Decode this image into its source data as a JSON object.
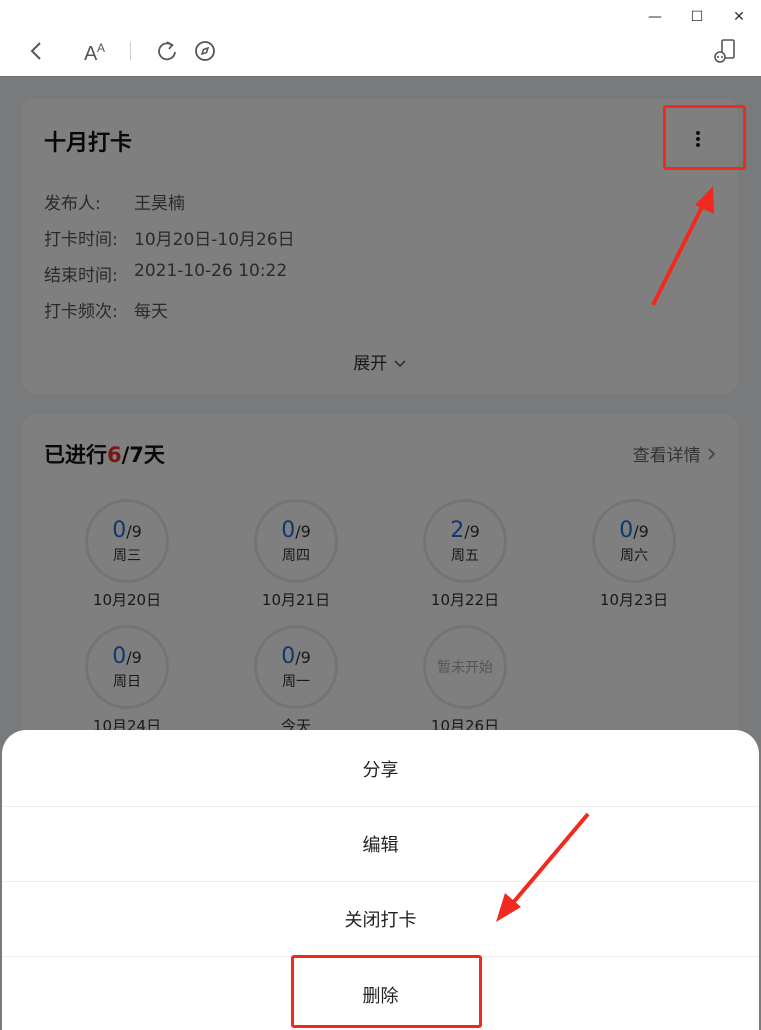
{
  "window": {
    "minimize_glyph": "—",
    "maximize_glyph": "☐",
    "close_glyph": "✕"
  },
  "toolbar": {
    "icons": [
      "back-icon",
      "font-size-icon",
      "refresh-icon",
      "compass-icon",
      "mini-program-icon"
    ]
  },
  "card1": {
    "title": "十月打卡",
    "rows": [
      {
        "label": "发布人:",
        "value": "王昊楠"
      },
      {
        "label": "打卡时间:",
        "value": "10月20日-10月26日"
      },
      {
        "label": "结束时间:",
        "value": "2021-10-26 10:22"
      },
      {
        "label": "打卡频次:",
        "value": "每天"
      }
    ],
    "expand_label": "展开"
  },
  "card2": {
    "title_prefix": "已进行",
    "title_done": "6",
    "title_suffix": "/7天",
    "detail_label": "查看详情",
    "days": [
      {
        "count": "0",
        "total": "/9",
        "weekday": "周三",
        "date": "10月20日"
      },
      {
        "count": "0",
        "total": "/9",
        "weekday": "周四",
        "date": "10月21日"
      },
      {
        "count": "2",
        "total": "/9",
        "weekday": "周五",
        "date": "10月22日"
      },
      {
        "count": "0",
        "total": "/9",
        "weekday": "周六",
        "date": "10月23日"
      },
      {
        "count": "0",
        "total": "/9",
        "weekday": "周日",
        "date": "10月24日"
      },
      {
        "count": "0",
        "total": "/9",
        "weekday": "周一",
        "date": "今天"
      },
      {
        "not_started": "暂未开始",
        "date": "10月26日"
      }
    ]
  },
  "sheet": {
    "items": [
      "分享",
      "编辑",
      "关闭打卡",
      "删除"
    ]
  },
  "colors": {
    "accent_blue": "#1e6fe0",
    "highlight_red": "#e5352b",
    "annotation_red": "#f02a1f"
  }
}
